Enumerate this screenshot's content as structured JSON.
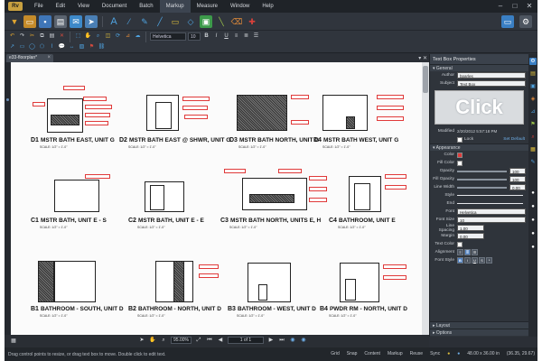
{
  "menu": {
    "items": [
      "File",
      "Edit",
      "View",
      "Document",
      "Batch",
      "Markup",
      "Measure",
      "Window",
      "Help"
    ],
    "active_index": 5
  },
  "toolbar": {
    "line_style_field": "Helvetica",
    "font_size_field": "10"
  },
  "document": {
    "tab_label": "e33-floorplan*",
    "sheets": [
      {
        "num": "D1",
        "title": "MSTR BATH EAST, UNIT G",
        "scale": "SCALE: 1/2\" = 1'-0\""
      },
      {
        "num": "D2",
        "title": "MSTR BATH EAST @ SHWR, UNIT G",
        "scale": "SCALE: 1/2\" = 1'-0\""
      },
      {
        "num": "D3",
        "title": "MSTR BATH NORTH, UNIT G",
        "scale": "SCALE: 1/2\" = 1'-0\""
      },
      {
        "num": "D4",
        "title": "MSTR BATH WEST, UNIT G",
        "scale": "SCALE: 1/2\" = 1'-0\""
      },
      {
        "num": "C1",
        "title": "MSTR BATH, UNIT E - S",
        "scale": "SCALE: 1/2\" = 1'-0\""
      },
      {
        "num": "C2",
        "title": "MSTR BATH, UNIT E - E",
        "scale": "SCALE: 1/2\" = 1'-0\""
      },
      {
        "num": "C3",
        "title": "MSTR BATH NORTH, UNITS E, H",
        "scale": "SCALE: 1/2\" = 1'-0\""
      },
      {
        "num": "C4",
        "title": "BATHROOM, UNIT E",
        "scale": "SCALE: 1/2\" = 1'-0\""
      },
      {
        "num": "B1",
        "title": "BATHROOM - SOUTH, UNIT D",
        "scale": "SCALE: 1/2\" = 1'-0\""
      },
      {
        "num": "B2",
        "title": "BATHROOM - NORTH, UNIT D",
        "scale": "SCALE: 1/2\" = 1'-0\""
      },
      {
        "num": "B3",
        "title": "BATHROOM - WEST, UNIT D",
        "scale": "SCALE: 1/2\" = 1'-0\""
      },
      {
        "num": "B4",
        "title": "PWDR RM - NORTH, UNIT D",
        "scale": "SCALE: 1/2\" = 1'-0\""
      }
    ]
  },
  "properties": {
    "header": "Text Box Properties",
    "general_label": "General",
    "author_label": "Author",
    "author_value": "bparles",
    "subject_label": "Subject",
    "subject_value": "Text Box",
    "preview_text": "Click",
    "modified_label": "Modified",
    "modified_value": "2/20/2012 5:57:18 PM",
    "lock_label": "Lock",
    "set_as_default": "Set Default",
    "appearance_label": "Appearance",
    "color_label": "Color",
    "fill_color_label": "Fill Color",
    "opacity_label": "Opacity",
    "opacity_value": "100",
    "fill_opacity_label": "Fill Opacity",
    "fill_opacity_value": "100",
    "line_width_label": "Line Width",
    "line_width_value": "0.00",
    "style_label": "Style",
    "end_label": "End",
    "font_label": "Font",
    "font_value": "Helvetica",
    "font_size_label": "Font Size",
    "font_size_value": "10",
    "line_spacing_label": "Line Spacing",
    "line_spacing_value": "1.00",
    "margin_label": "Margin",
    "margin_value": "0.00",
    "text_color_label": "Text Color",
    "alignment_label": "Alignment",
    "font_style_label": "Font Style",
    "layout_label": "Layout",
    "options_label": "Options",
    "colors": {
      "color": "#e23b3b",
      "fill": "#ffffff",
      "text": "#ffffff"
    }
  },
  "nav": {
    "zoom": "95.00%",
    "page": "1 of 1"
  },
  "status": {
    "hint": "Drag control points to resize, or drag text box to move. Double click to edit text.",
    "right_items": [
      "Grid",
      "Snap",
      "Content",
      "Markup",
      "Reuse",
      "Sync"
    ],
    "dimensions": "48.00 x 36.00 in",
    "coords": "(36.35, 29.67)"
  }
}
